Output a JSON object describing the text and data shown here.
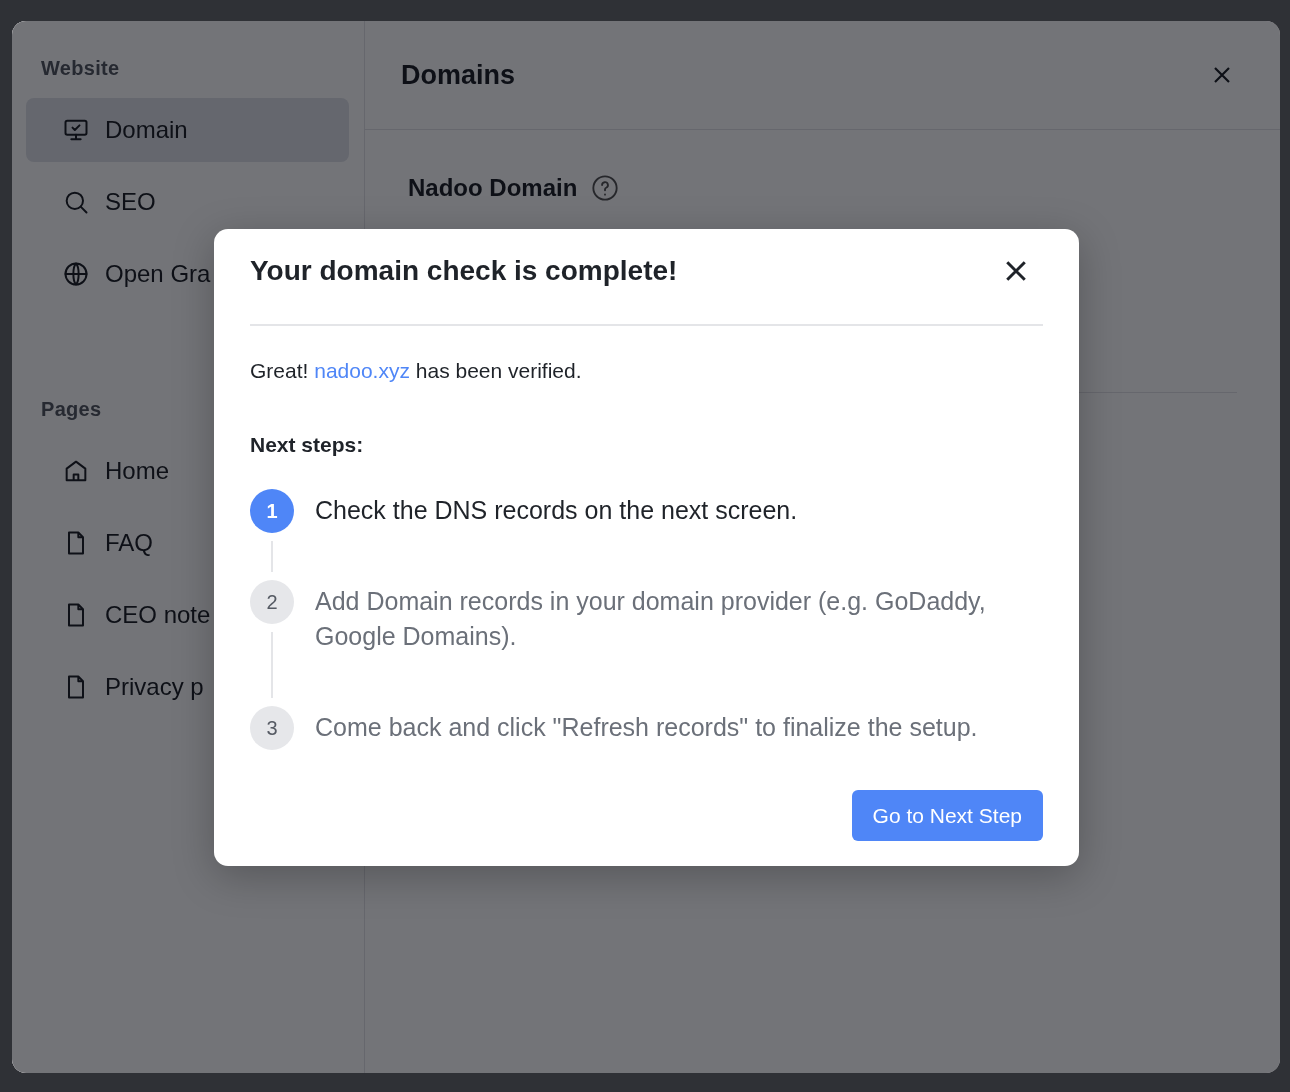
{
  "sidebar": {
    "sections": [
      {
        "title": "Website",
        "items": [
          {
            "label": "Domain",
            "selected": true
          },
          {
            "label": "SEO",
            "selected": false
          },
          {
            "label": "Open Gra",
            "selected": false
          }
        ]
      },
      {
        "title": "Pages",
        "items": [
          {
            "label": "Home",
            "selected": false
          },
          {
            "label": "FAQ",
            "selected": false
          },
          {
            "label": "CEO note",
            "selected": false
          },
          {
            "label": "Privacy p",
            "selected": false
          }
        ]
      }
    ]
  },
  "main": {
    "title": "Domains",
    "field_label": "Nadoo Domain"
  },
  "dialog": {
    "title": "Your domain check is complete!",
    "message": {
      "before": "Great!",
      "link": "nadoo.xyz",
      "after": "has been verified."
    },
    "steps_heading": "Next steps:",
    "steps": [
      {
        "number": "1",
        "text": "Check the DNS records on the next screen.",
        "active": true
      },
      {
        "number": "2",
        "text": "Add Domain records in your domain provider (e.g. GoDaddy, Google Domains).",
        "active": false
      },
      {
        "number": "3",
        "text": "Come back and click \"Refresh records\" to finalize the setup.",
        "active": false
      }
    ],
    "button": "Go to Next Step"
  }
}
